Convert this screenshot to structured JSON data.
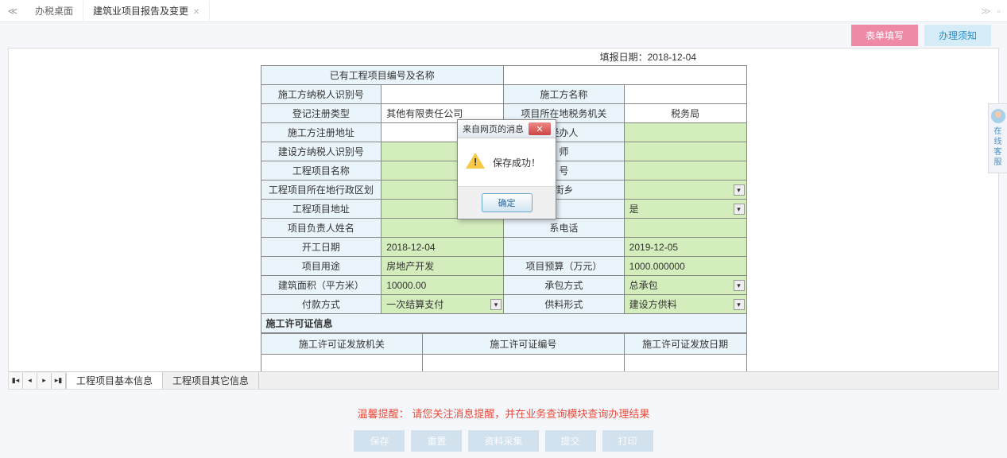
{
  "tabs": {
    "main": "办税桌面",
    "second": "建筑业项目报告及变更"
  },
  "subBtns": {
    "pink": "表单填写",
    "blue": "办理须知"
  },
  "fillDateLabel": "填报日期：",
  "fillDate": "2018-12-04",
  "form": {
    "r1_l": "已有工程项目编号及名称",
    "r2_l": "施工方纳税人识别号",
    "r2_r": "施工方名称",
    "r3_l": "登记注册类型",
    "r3_lv": "其他有限责任公司",
    "r3_r": "项目所在地税务机关",
    "r3_rv": "税务局",
    "r4_l": "施工方注册地址",
    "r4_r": "经办人",
    "r5_l": "建设方纳税人识别号",
    "r5_r": "师",
    "r6_l": "工程项目名称",
    "r6_r": "号",
    "r7_l": "工程项目所在地行政区划",
    "r7_r": "街乡",
    "r8_l": "工程项目地址",
    "r8_r": "是",
    "r9_l": "项目负责人姓名",
    "r9_r": "系电话",
    "r10_l": "开工日期",
    "r10_lv": "2018-12-04",
    "r10_r": "",
    "r10_rv": "2019-12-05",
    "r11_l": "项目用途",
    "r11_lv": "房地产开发",
    "r11_r": "项目预算（万元）",
    "r11_rv": "1000.000000",
    "r12_l": "建筑面积（平方米）",
    "r12_lv": "10000.00",
    "r12_r": "承包方式",
    "r12_rv": "总承包",
    "r13_l": "付款方式",
    "r13_lv": "一次结算支付",
    "r13_r": "供料形式",
    "r13_rv": "建设方供料"
  },
  "permitSection": "施工许可证信息",
  "permitHeaders": {
    "c1": "施工许可证发放机关",
    "c2": "施工许可证编号",
    "c3": "施工许可证发放日期"
  },
  "sheetTabs": {
    "t1": "工程项目基本信息",
    "t2": "工程项目其它信息"
  },
  "warning": {
    "label": "温馨提醒：",
    "text": "请您关注消息提醒，并在业务查询模块查询办理结果"
  },
  "actionBtns": {
    "b1": "保存",
    "b2": "重置",
    "b3": "资料采集",
    "b4": "提交",
    "b5": "打印"
  },
  "helpText": "在线客服",
  "modal": {
    "title": "来自网页的消息",
    "body": "保存成功！",
    "ok": "确定"
  }
}
